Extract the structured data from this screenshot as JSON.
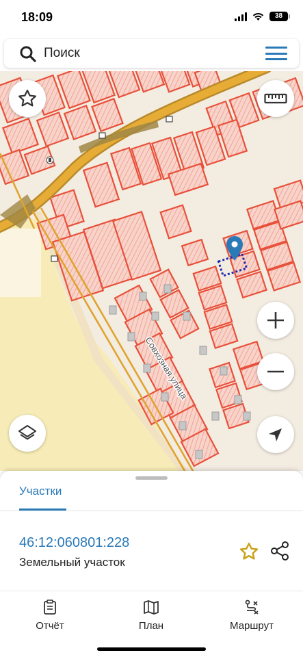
{
  "status_bar": {
    "time": "18:09",
    "battery": "38"
  },
  "search": {
    "placeholder": "Поиск"
  },
  "map": {
    "street_label": "Совхозная улица",
    "icons": [
      "star-icon",
      "ruler-icon",
      "layers-icon",
      "zoom-in-icon",
      "zoom-out-icon",
      "locate-arrow-icon",
      "location-pin-icon"
    ],
    "colors": {
      "parcel_border": "#e8503a",
      "parcel_fill": "#f6c6bb",
      "road": "#e0a32e",
      "field": "#f7ecb7",
      "accent": "#2a7ab8",
      "selection": "#1f2bb0"
    }
  },
  "sheet": {
    "tab_label": "Участки",
    "parcel_id": "46:12:060801:228",
    "parcel_type": "Земельный участок"
  },
  "bottom_nav": {
    "items": [
      {
        "label": "Отчёт",
        "icon": "report-icon"
      },
      {
        "label": "План",
        "icon": "map-icon"
      },
      {
        "label": "Маршрут",
        "icon": "route-icon"
      }
    ]
  }
}
